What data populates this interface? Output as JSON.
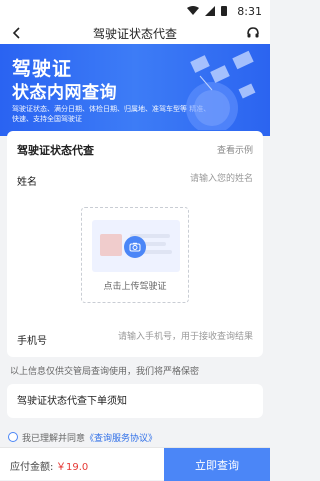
{
  "status": {
    "time": "8:31"
  },
  "header": {
    "title": "驾驶证状态代查",
    "back_icon": "back-arrow-icon",
    "support_icon": "headset-icon"
  },
  "banner": {
    "title_line1": "驾驶证",
    "title_line2": "状态内网查询",
    "description": "驾驶证状态、满分日期、体检日期、归属地、准驾车型等 精准、快速、支持全国驾驶证"
  },
  "form": {
    "card_title": "驾驶证状态代查",
    "example_link": "查看示例",
    "name_label": "姓名",
    "name_placeholder": "请输入您的姓名",
    "upload_label": "点击上传驾驶证",
    "phone_label": "手机号",
    "phone_placeholder": "请输入手机号，用于接收查询结果",
    "privacy_note": "以上信息仅供交管局查询使用，我们将严格保密"
  },
  "notice": {
    "title": "驾驶证状态代查下单须知"
  },
  "agreement": {
    "text": "我已理解并同意",
    "link": "《查询服务协议》"
  },
  "footer": {
    "amount_label": "应付金额:",
    "amount_value": "￥19.0",
    "submit_label": "立即查询"
  },
  "colors": {
    "primary": "#4b86f7",
    "price": "#e53935"
  }
}
